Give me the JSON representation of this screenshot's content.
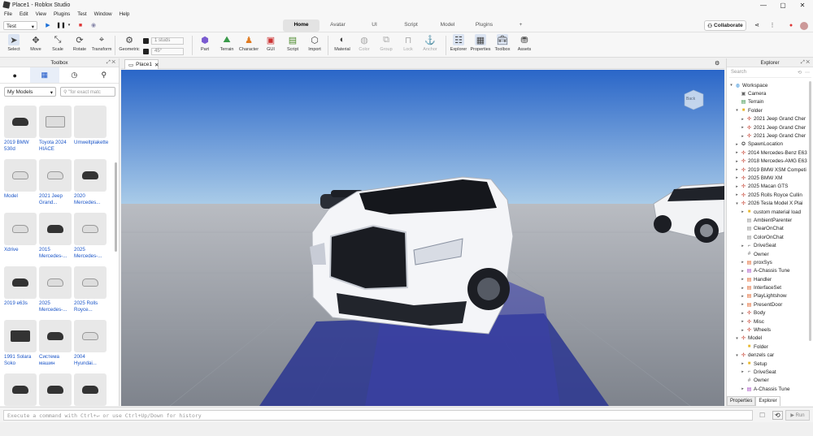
{
  "window": {
    "title": "Place1 - Roblox Studio",
    "controls": [
      "—",
      "▢",
      "✕"
    ]
  },
  "menu": [
    "File",
    "Edit",
    "View",
    "Plugins",
    "Test",
    "Window",
    "Help"
  ],
  "mode": "Test",
  "tabs": [
    {
      "label": "Home",
      "active": true
    },
    {
      "label": "Avatar"
    },
    {
      "label": "UI"
    },
    {
      "label": "Script"
    },
    {
      "label": "Model"
    },
    {
      "label": "Plugins"
    },
    {
      "label": "+"
    }
  ],
  "collaborate": "Collaborate",
  "tools": {
    "select": "Select",
    "move": "Move",
    "scale": "Scale",
    "rotate": "Rotate",
    "transform": "Transform",
    "geometric": "Geometric",
    "studs": "1 studs",
    "angle": "45°",
    "part": "Part",
    "terrain": "Terrain",
    "character": "Character",
    "gui": "GUI",
    "script": "Script",
    "import": "Import",
    "material": "Material",
    "color": "Color",
    "group": "Group",
    "lock": "Lock",
    "anchor": "Anchor",
    "explorer": "Explorer",
    "properties": "Properties",
    "toolbox": "Toolbox",
    "assets": "Assets"
  },
  "toolbox": {
    "title": "Toolbox",
    "category": "My Models",
    "search_placeholder": "\"for exact matc",
    "items": [
      {
        "name": "2019 BMW 530d",
        "thumb": "dark"
      },
      {
        "name": "Toyota 2024 HIACE",
        "thumb": "van"
      },
      {
        "name": "Umweltplakette",
        "thumb": "blank"
      },
      {
        "name": "Model",
        "thumb": "white"
      },
      {
        "name": "2021 Jeep Grand...",
        "thumb": "grey"
      },
      {
        "name": "2020 Mercedes...",
        "thumb": "dark"
      },
      {
        "name": "Xdrive",
        "thumb": "white"
      },
      {
        "name": "2015 Mercedes-...",
        "thumb": "dark"
      },
      {
        "name": "2025 Mercedes-...",
        "thumb": "white"
      },
      {
        "name": "2019 e63s",
        "thumb": "dark"
      },
      {
        "name": "2025 Mercedes-...",
        "thumb": "white"
      },
      {
        "name": "2025 Rolls Royce...",
        "thumb": "white"
      },
      {
        "name": "1991 Solara Soko",
        "thumb": "truck"
      },
      {
        "name": "Система машин",
        "thumb": "dark"
      },
      {
        "name": "2004 Hyundai...",
        "thumb": "white"
      },
      {
        "name": "",
        "thumb": "dark"
      },
      {
        "name": "",
        "thumb": "dark"
      },
      {
        "name": "",
        "thumb": "dark"
      }
    ]
  },
  "viewport": {
    "tab": "Place1",
    "view_cube_label": "Back"
  },
  "explorer": {
    "title": "Explorer",
    "search_placeholder": "Search",
    "tree": [
      {
        "label": "Workspace",
        "indent": 0,
        "arrow": "▾",
        "icon": "workspace"
      },
      {
        "label": "Camera",
        "indent": 1,
        "arrow": "",
        "icon": "camera"
      },
      {
        "label": "Terrain",
        "indent": 1,
        "arrow": "",
        "icon": "terrain"
      },
      {
        "label": "Folder",
        "indent": 1,
        "arrow": "▾",
        "icon": "folder"
      },
      {
        "label": "2021 Jeep Grand Cher",
        "indent": 2,
        "arrow": "▸",
        "icon": "model"
      },
      {
        "label": "2021 Jeep Grand Cher",
        "indent": 2,
        "arrow": "▸",
        "icon": "model"
      },
      {
        "label": "2021 Jeep Grand Cher",
        "indent": 2,
        "arrow": "▸",
        "icon": "model"
      },
      {
        "label": "SpawnLocation",
        "indent": 1,
        "arrow": "▸",
        "icon": "spawn"
      },
      {
        "label": "2014 Mercedes-Benz E63",
        "indent": 1,
        "arrow": "▸",
        "icon": "model"
      },
      {
        "label": "2018 Mercedes-AMG E63",
        "indent": 1,
        "arrow": "▸",
        "icon": "model"
      },
      {
        "label": "2019 BMW XSM Competi",
        "indent": 1,
        "arrow": "▸",
        "icon": "model"
      },
      {
        "label": "2025 BMW XM",
        "indent": 1,
        "arrow": "▸",
        "icon": "model"
      },
      {
        "label": "2025 Macan GTS",
        "indent": 1,
        "arrow": "▸",
        "icon": "model"
      },
      {
        "label": "2025 Rolls Royce Cullin",
        "indent": 1,
        "arrow": "▸",
        "icon": "model"
      },
      {
        "label": "2026 Tesla Model X Plai",
        "indent": 1,
        "arrow": "▾",
        "icon": "model"
      },
      {
        "label": "custom material load",
        "indent": 2,
        "arrow": "▸",
        "icon": "folder"
      },
      {
        "label": "AmbientParenter",
        "indent": 2,
        "arrow": "",
        "icon": "script"
      },
      {
        "label": "ClearOnChat",
        "indent": 2,
        "arrow": "",
        "icon": "script"
      },
      {
        "label": "ColorOnChat",
        "indent": 2,
        "arrow": "",
        "icon": "script"
      },
      {
        "label": "DriveSeat",
        "indent": 2,
        "arrow": "▸",
        "icon": "seat"
      },
      {
        "label": "Owner",
        "indent": 2,
        "arrow": "",
        "icon": "value"
      },
      {
        "label": "proxSys",
        "indent": 2,
        "arrow": "▸",
        "icon": "script-red"
      },
      {
        "label": "A-Chassis Tune",
        "indent": 2,
        "arrow": "▸",
        "icon": "module"
      },
      {
        "label": "Handler",
        "indent": 2,
        "arrow": "▸",
        "icon": "script-red"
      },
      {
        "label": "InterfaceSet",
        "indent": 2,
        "arrow": "▸",
        "icon": "script-red"
      },
      {
        "label": "PlayLightshow",
        "indent": 2,
        "arrow": "▸",
        "icon": "script-red"
      },
      {
        "label": "PresentDoor",
        "indent": 2,
        "arrow": "▸",
        "icon": "script-red"
      },
      {
        "label": "Body",
        "indent": 2,
        "arrow": "▸",
        "icon": "model"
      },
      {
        "label": "Misc",
        "indent": 2,
        "arrow": "▸",
        "icon": "model"
      },
      {
        "label": "Wheels",
        "indent": 2,
        "arrow": "▸",
        "icon": "model"
      },
      {
        "label": "Model",
        "indent": 1,
        "arrow": "▾",
        "icon": "model"
      },
      {
        "label": "Folder",
        "indent": 2,
        "arrow": "",
        "icon": "folder"
      },
      {
        "label": "denzels car",
        "indent": 1,
        "arrow": "▾",
        "icon": "model"
      },
      {
        "label": "Setup",
        "indent": 2,
        "arrow": "▸",
        "icon": "folder"
      },
      {
        "label": "DriveSeat",
        "indent": 2,
        "arrow": "▸",
        "icon": "seat"
      },
      {
        "label": "Owner",
        "indent": 2,
        "arrow": "",
        "icon": "value"
      },
      {
        "label": "A-Chassis Tune",
        "indent": 2,
        "arrow": "▸",
        "icon": "module"
      }
    ],
    "bottom_tabs": [
      "Properties",
      "Explorer"
    ]
  },
  "command_bar": {
    "placeholder": "Execute a command with Ctrl+↵ or use Ctrl+Up/Down for history",
    "run": "▶ Run"
  },
  "colors": {
    "accent": "#1a55c8",
    "sky_top": "#2d6fd0",
    "sky_bottom": "#a8c8e8",
    "floor": "#8a8f98"
  }
}
